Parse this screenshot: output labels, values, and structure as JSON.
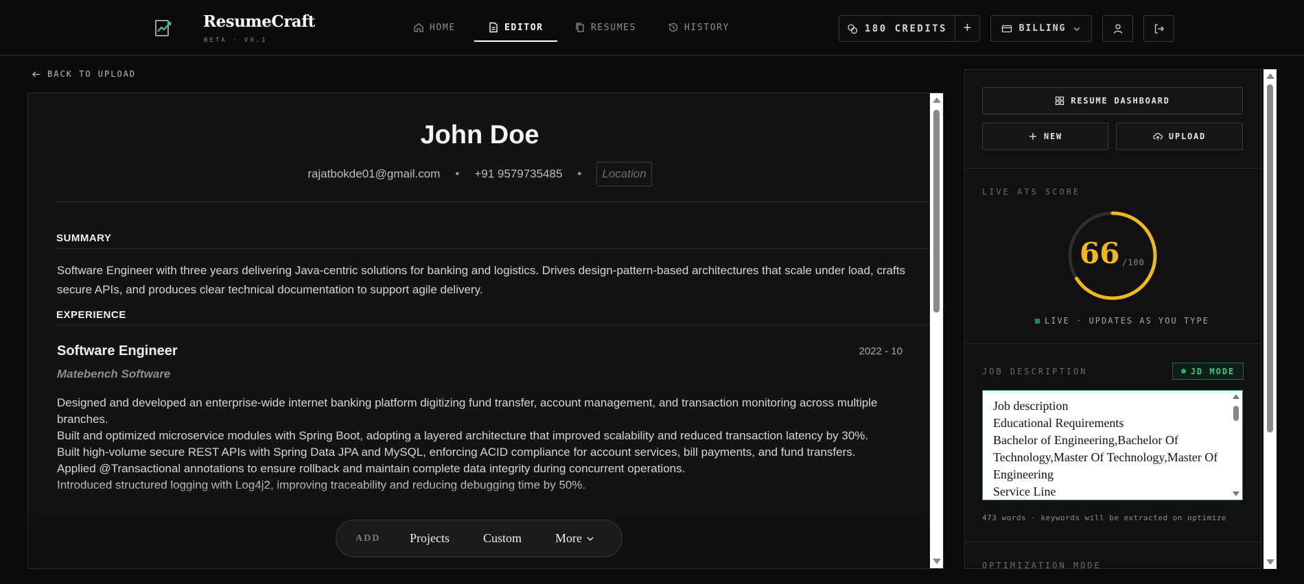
{
  "header": {
    "brand": "ResumeCraft",
    "brand_sub": "BETA · V0.1",
    "nav": [
      {
        "label": "HOME",
        "icon": "home-icon"
      },
      {
        "label": "EDITOR",
        "icon": "document-icon",
        "active": true
      },
      {
        "label": "RESUMES",
        "icon": "copy-icon"
      },
      {
        "label": "HISTORY",
        "icon": "history-icon"
      }
    ],
    "credits_label": "180 CREDITS",
    "credits_add": "+",
    "billing_label": "BILLING"
  },
  "back_link": "BACK TO UPLOAD",
  "resume": {
    "name": "John Doe",
    "email": "rajatbokde01@gmail.com",
    "phone": "+91 9579735485",
    "separator": "•",
    "location_placeholder": "Location",
    "summary_title": "SUMMARY",
    "summary": "Software Engineer with three years delivering Java-centric solutions for banking and logistics. Drives design-pattern-based architectures that scale under load, crafts secure APIs, and produces clear technical documentation to support agile delivery.",
    "experience_title": "EXPERIENCE",
    "experience": [
      {
        "title": "Software Engineer",
        "date": "2022 - 10",
        "company": "Matebench Software",
        "bullets": [
          "Designed and developed an enterprise-wide internet banking platform digitizing fund transfer, account management, and transaction monitoring across multiple branches.",
          "Built and optimized microservice modules with Spring Boot, adopting a layered architecture that improved scalability and reduced transaction latency by 30%.",
          "Built high-volume secure REST APIs with Spring Data JPA and MySQL, enforcing ACID compliance for account services, bill payments, and fund transfers.",
          "Applied @Transactional annotations to ensure rollback and maintain complete data integrity during concurrent operations.",
          "Introduced structured logging with Log4j2, improving traceability and reducing debugging time by 50%."
        ]
      }
    ]
  },
  "addbar": {
    "label": "ADD",
    "options": [
      "Projects",
      "Custom",
      "More"
    ]
  },
  "sidebar": {
    "dashboard_button": "RESUME DASHBOARD",
    "new_button": "NEW",
    "upload_button": "UPLOAD",
    "ats_label": "LIVE ATS SCORE",
    "ats_score": 66,
    "ats_max": "/100",
    "live_text": "LIVE · UPDATES AS YOU TYPE",
    "jd_label": "JOB DESCRIPTION",
    "jd_mode": "JD MODE",
    "jd_lines": [
      "Job description",
      "Educational Requirements",
      "Bachelor of Engineering,Bachelor Of Technology,Master Of Technology,Master Of Engineering",
      "Service Line"
    ],
    "jd_meta": "473 words · keywords will be extracted on optimize",
    "optimization_label": "OPTIMIZATION MODE"
  },
  "colors": {
    "accent_gold": "#f1b81e",
    "live_green": "#1f8a5e",
    "jd_green": "#38c98a"
  }
}
